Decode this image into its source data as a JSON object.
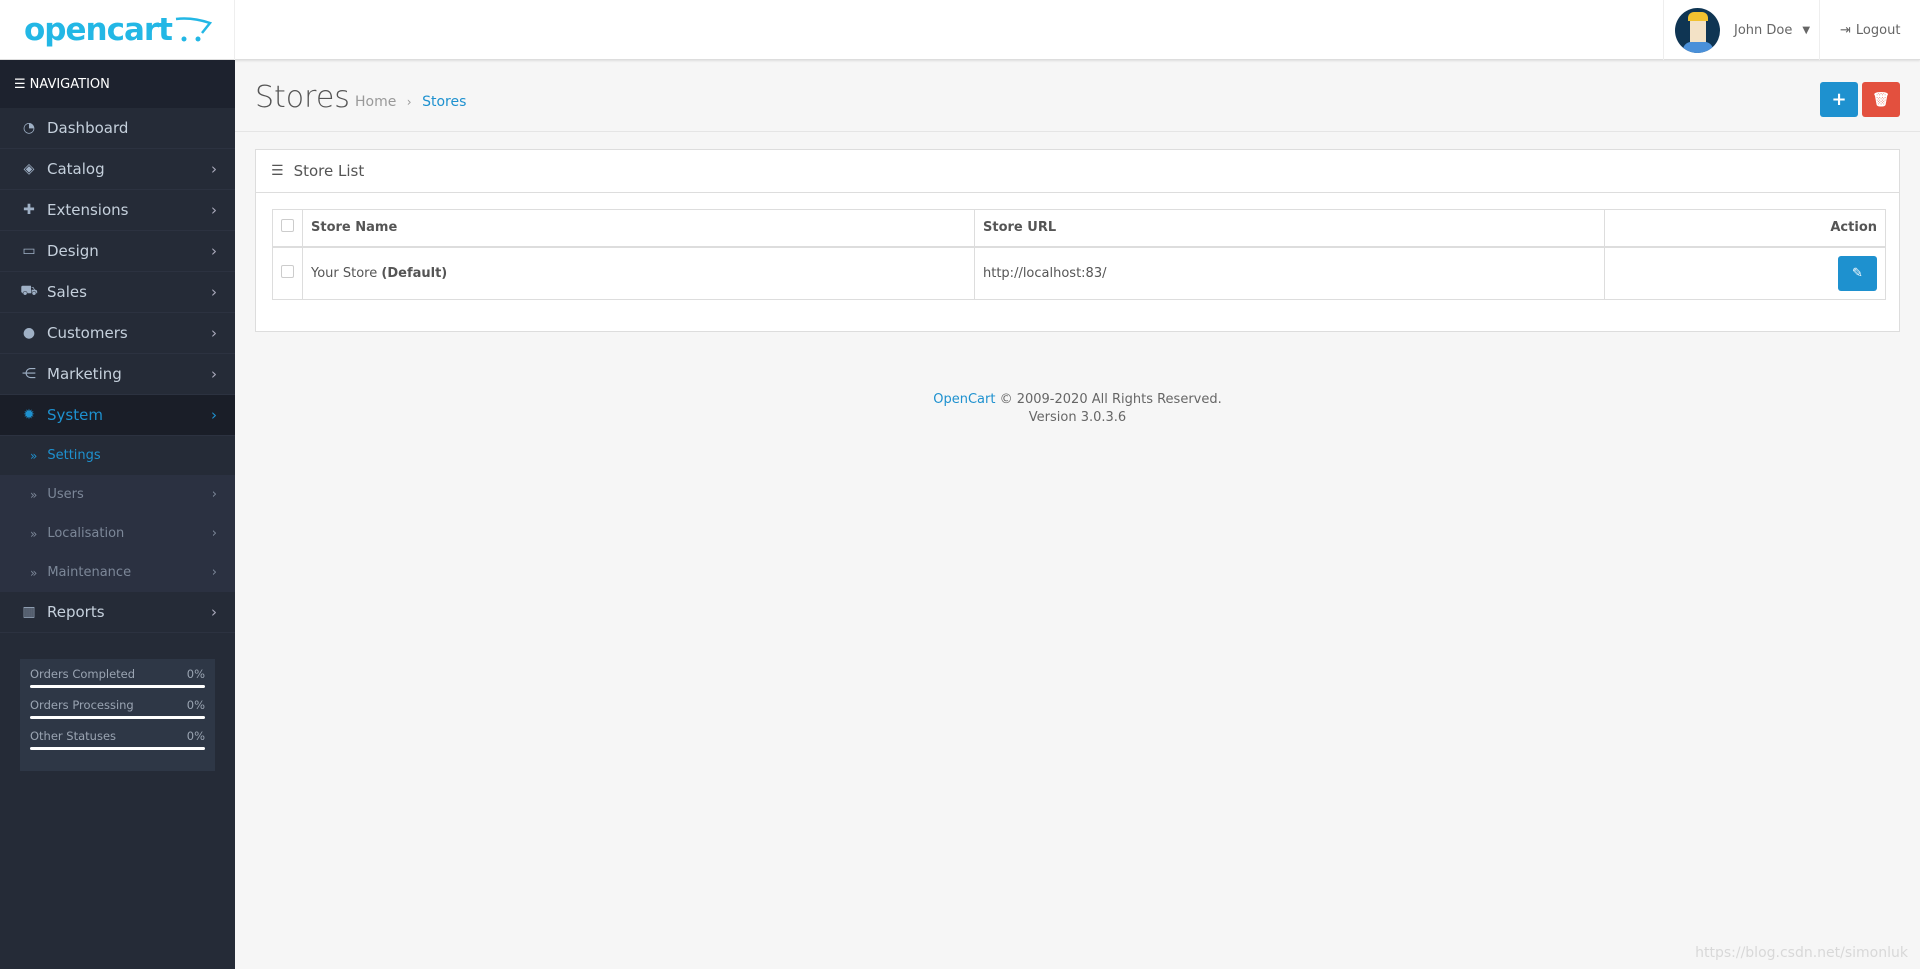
{
  "header": {
    "logo_text": "opencart",
    "user_name": "John Doe",
    "logout_label": "Logout"
  },
  "nav": {
    "title": "NAVIGATION",
    "items": [
      {
        "label": "Dashboard",
        "icon": "dashboard-icon",
        "glyph": "◔"
      },
      {
        "label": "Catalog",
        "icon": "tags-icon",
        "glyph": "◈"
      },
      {
        "label": "Extensions",
        "icon": "puzzle-icon",
        "glyph": "✚"
      },
      {
        "label": "Design",
        "icon": "monitor-icon",
        "glyph": "▭"
      },
      {
        "label": "Sales",
        "icon": "cart-icon",
        "glyph": "⛟"
      },
      {
        "label": "Customers",
        "icon": "user-icon",
        "glyph": "●"
      },
      {
        "label": "Marketing",
        "icon": "share-icon",
        "glyph": "⋲"
      },
      {
        "label": "System",
        "icon": "gear-icon",
        "glyph": "✹"
      }
    ],
    "system_sub": [
      {
        "label": "Settings"
      },
      {
        "label": "Users"
      },
      {
        "label": "Localisation"
      },
      {
        "label": "Maintenance"
      }
    ],
    "reports": {
      "label": "Reports",
      "icon": "bar-chart-icon",
      "glyph": "▥"
    },
    "stats": [
      {
        "label": "Orders Completed",
        "value": "0%",
        "progress": 0
      },
      {
        "label": "Orders Processing",
        "value": "0%",
        "progress": 0
      },
      {
        "label": "Other Statuses",
        "value": "0%",
        "progress": 0
      }
    ]
  },
  "page": {
    "title": "Stores",
    "breadcrumb": [
      "Home",
      "Stores"
    ],
    "add_color": "#1e91cf",
    "delete_color": "#e3503e"
  },
  "panel": {
    "title": "Store List",
    "columns": [
      "Store Name",
      "Store URL",
      "Action"
    ],
    "rows": [
      {
        "name": "Your Store",
        "suffix": "(Default)",
        "url": "http://localhost:83/"
      }
    ]
  },
  "footer": {
    "brand": "OpenCart",
    "copyright": "© 2009-2020 All Rights Reserved.",
    "version": "Version 3.0.3.6"
  },
  "watermark": "https://blog.csdn.net/simonluk"
}
